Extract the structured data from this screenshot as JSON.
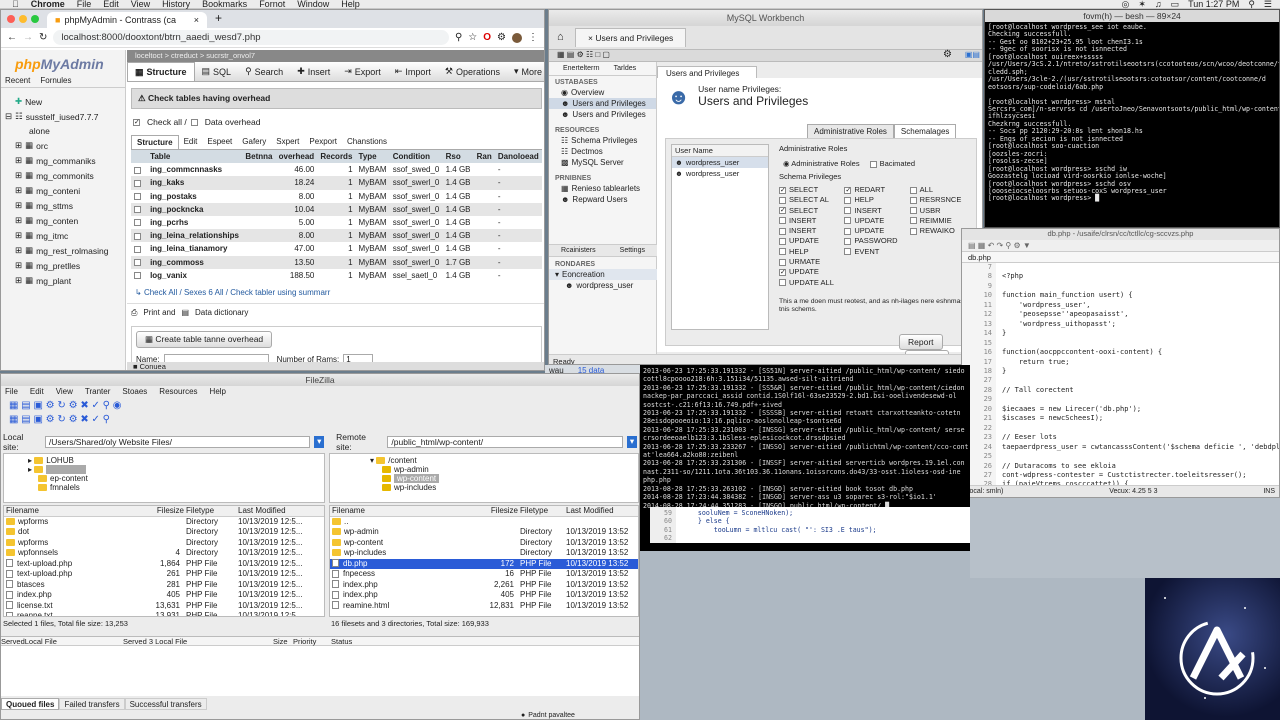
{
  "menubar": {
    "app": "Chrome",
    "items": [
      "File",
      "Edit",
      "View",
      "History",
      "Bookmarks",
      "Fornot",
      "Window",
      "Help"
    ],
    "clock": "Tun 1:27 PM"
  },
  "chrome": {
    "tab_title": "phpMyAdmin - Contrass (ca",
    "url": "localhost:8000/dooxtont/btrn_aaedi_wesd7.php"
  },
  "pma": {
    "logo_a": "php",
    "logo_b": "MyAdmin",
    "recent": "Recent",
    "favorites": "Fornules",
    "tree": [
      "New",
      "susstelf_iused7.7.7",
      "alone",
      "orc",
      "mg_commaniks",
      "mg_commonits",
      "mg_conteni",
      "mg_sttms",
      "mg_conten",
      "mg_itmc",
      "mg_rest_rolmasing",
      "mg_pretlles",
      "mg_plant"
    ],
    "breadcrumb": "loceltoct  >  ctreduct  >  sucrstr_onvol7",
    "tabs": [
      "Structure",
      "SQL",
      "Search",
      "Insert",
      "Export",
      "Import",
      "Operations",
      "More"
    ],
    "notice": "Check tables having overhead",
    "check_all": "Check all /",
    "data_overhead": "Data overhead",
    "subtabs": [
      "Structure",
      "Edit",
      "Espeet",
      "Gafery",
      "Sxpert",
      "Pexport",
      "Chanstions"
    ],
    "columns": [
      "Table",
      "Betnna",
      "overhead",
      "Records",
      "Type",
      "Condition",
      "Rso",
      "Ran",
      "Danoloead"
    ],
    "rows": [
      [
        "ing_commcnnasks",
        "",
        "46.00",
        "1",
        "MyBAM",
        "ssof_swed_0",
        "1.4 GB",
        "",
        "-"
      ],
      [
        "ing_kaks",
        "",
        "18.24",
        "1",
        "MyBAM",
        "ssof_swerl_0",
        "1.4 GB",
        "",
        "-"
      ],
      [
        "ing_postaks",
        "",
        "8.00",
        "1",
        "MyBAM",
        "ssof_swerl_0",
        "1.4 GB",
        "",
        "-"
      ],
      [
        "ing_pockncka",
        "",
        "10.04",
        "1",
        "MyBAM",
        "ssof_swerl_0",
        "1.4 GB",
        "",
        "-"
      ],
      [
        "ing_pcrhs",
        "",
        "5.00",
        "1",
        "MyBAM",
        "ssof_swerl_0",
        "1.4 GB",
        "",
        "-"
      ],
      [
        "ing_leina_relationships",
        "",
        "8.00",
        "1",
        "MyBAM",
        "ssof_swerl_0",
        "1.4 GB",
        "",
        "-"
      ],
      [
        "ing_leina_tianamory",
        "",
        "47.00",
        "1",
        "MyBAM",
        "ssof_swerl_0",
        "1.4 GB",
        "",
        "-"
      ],
      [
        "ing_commoss",
        "",
        "13.50",
        "1",
        "MyBAM",
        "ssof_swerl_0",
        "1.7 GB",
        "",
        "-"
      ],
      [
        "log_vanix",
        "",
        "188.50",
        "1",
        "MyBAM",
        "ssel_saetl_0",
        "1.4 GB",
        "",
        "-"
      ]
    ],
    "footer_check": "Check All / Sexes 6 All / Check tabler using summarr",
    "print": "Print and",
    "data_dict": "Data dictionary",
    "create_btn": "Create table tanne overhead",
    "name_label": "Name:",
    "cols_label": "Number of Rams:",
    "cols_value": "1",
    "console": "Conuea"
  },
  "wb": {
    "title": "MySQL Workbench",
    "tab": "Users and Privileges",
    "side_tabs": [
      "Enertelterrn",
      "Tarldes"
    ],
    "main_tab": "Users and Privileges",
    "groups": [
      {
        "hdr": "USTABASES",
        "items": [
          "Overview",
          "Users and Privileges",
          "Users and Privileges"
        ]
      },
      {
        "hdr": "RESOURCES",
        "items": [
          "Schema Privileges",
          "Dectmos",
          "MySQL Server"
        ]
      },
      {
        "hdr": "PRNIBNES",
        "items": [
          "Renieso tablearlets",
          "Repward Users"
        ]
      }
    ],
    "side_bottom": [
      "Rcainisters",
      "Settings"
    ],
    "rondares": "RONDARES",
    "econ": "Eoncreation",
    "econ_user": "wordpress_user",
    "header_sub": "User name Privileges:",
    "header_title": "Users and Privileges",
    "right_tabs": [
      "Administrative Roles",
      "Schemalages"
    ],
    "user_list_hdr": "User Name",
    "users": [
      "wordpress_user",
      "wordpress_user"
    ],
    "admin_roles": "Administrative Roles",
    "radio_a": "Administrative Roles",
    "radio_b": "Bacimated",
    "schema_priv": "Schema Privileges",
    "priv_col1": [
      [
        "SELECT",
        true
      ],
      [
        "SELECT AL",
        false
      ],
      [
        "SELECT",
        true
      ],
      [
        "INSERT",
        false
      ],
      [
        "INSERT",
        false
      ],
      [
        "UPDATE",
        false
      ],
      [
        "HELP",
        false
      ],
      [
        "URMATE",
        false
      ],
      [
        "UPDATE",
        true
      ],
      [
        "UPDATE ALL",
        false
      ]
    ],
    "priv_col2": [
      [
        "REDART",
        true
      ],
      [
        "HELP",
        false
      ],
      [
        "INSERT",
        false
      ],
      [
        "UPDATE",
        false
      ],
      [
        "UPDATE",
        false
      ],
      [
        "PASSWORD",
        false
      ],
      [
        "EVENT",
        false
      ]
    ],
    "priv_col3": [
      [
        "ALL",
        false
      ],
      [
        "RESRSNCE",
        false
      ],
      [
        "USBR",
        false
      ],
      [
        "REIMMIE",
        false
      ],
      [
        "REWAIKO",
        false
      ]
    ],
    "note": "This a me doen must reotest, and as nh-ilages nere eshnmasing tnis schems.",
    "report": "Report",
    "cancel": "Cancel",
    "status": "Ready"
  },
  "term1": {
    "title": "fovm(h) — besh — 89×24",
    "lines": [
      "[root@localhost wordpress_see iot eaube.",
      "Checking successfull.",
      "-- Gest oo 8102+23+25.95 loot chenI3.1s",
      "-- 9gec of soorisx is not isnnected",
      "[root@localhost ouireex+sssss",
      "/usr/Users/3cS.2.1/ntreto/sstrotilseootsrs(ccotooteos/scn/wcoo/deotconne/t",
      "cledd.sph;",
      "/usr/Users/3cle-2./(usr/sstrotilseootsrs:cotootsor/content/cootconne/d",
      "eotsosrs/sup-codeloid/6ab.php",
      "",
      "[root@localhost wordpress> mstal",
      "Sercsrs_com]/n-servrss cd /usertoJneo/Senavontsoots/public_html/wp-content",
      "ifhlzsycsesi",
      "Chezkrng successfull.",
      "-- Socs pp 2120:29-20:8s lent shon18.hs",
      "-- Engs of secion is not isnnected",
      "[root@localhost soo-cuaction",
      "[oozsles-zocri:",
      "[rosolss-zecse]",
      "[root@localhost wordpress> sschd iw",
      "Goozastelg locioad vird-oosrkio ionlse-woche]",
      "[root@localhost wordpress> sschd osv",
      "[oooseiocseloosrbs setuos-coxS wordpress_user",
      "[root@localhost wordpress> "
    ]
  },
  "editor": {
    "path": "db.php - /usaife/clrsn/cc/tctllc/cg-sccvzs.php",
    "tab": "db.php",
    "gutter": [
      "7",
      "8",
      "9",
      "10",
      "11",
      "12",
      "13",
      "14",
      "15",
      "16",
      "17",
      "18",
      "27",
      "28",
      "29",
      "20",
      "21",
      "22",
      "23",
      "24",
      "25",
      "26",
      "27",
      "28",
      "29",
      "30"
    ],
    "lines": [
      "",
      "<?php",
      "",
      "function main_function usert) {",
      "    'wordpress_user',",
      "    'peosepsse''apeopasaisst',",
      "    'wordpress_uithopasst';",
      "}",
      "",
      "function(aocppccontent-ooxi-content) {",
      "    return true;",
      "}",
      "",
      "// Tall corectent",
      "",
      "$iecaaes = new Lirecer('db.php');",
      "$iscases = newcScheesI);",
      "",
      "// Eeser lots",
      "taepaerdpress_user = cwtancasssContent('$schema deficie ', 'debdpl');",
      "",
      "// Dutaracoms to see ekloia",
      "cont-wdpress-contester = Custctistrecter.toeleitsresser();",
      "if (paieVtrems.coscccattet)) {",
      "   (wiesttresse-ocsteitr = coucntel(npptcclalite.collig).size(ihe",
      "   if (pstttresse-ccosstzr.courstst)) {"
    ],
    "status_left": "Tocal: smln)",
    "status_mid": "Vecux: 4.25 5 3",
    "status_right": "INS"
  },
  "term2": {
    "lines": [
      "2013-06-23 17:25:33.191332 - [SS51N] server-aitied /public_html/wp-content/ siedo",
      "cottl8cpoooo218:6h:3.151i34/51135.awsed-silt-aitriend",
      "2013-06-23 17:25:33.191332 - [SS5&R] server-eitied /public_html/wp-content/ciedon",
      "nackep-par_parccaci_assid contid.1S0lf16l-63se23529-2.bd1.bsi-ooelivendesewd-ol",
      "sostcst-.c21:6f13:16.749.pdf+-sived",
      "2013-06-23 17:25:33.191332 - [SSSSB] server-eitied retoatt ctarxotteankto-cotetn",
      "28eisdopooeoio:13:16.pqlico-aoslonolleap-tsontse6d",
      "2013-06-28 17:25:33.231003 - [INSSG] server-eitied /public_html/wp-content/ serse",
      "crsordeeoaelb123:3.1bSless-eplesicockcot.drssdpsied",
      "2013-06-28 17:25:33.233267 - [INSSO] server-eitied /publichtml/wp-content/cco-cont",
      "at'lea664.a2ko80:zeibenl",
      "2013-06-28 17:25:33.231306 - [INSSF] server-aitied serverticb wordpres.19.1el.con",
      "nast.2311-so/1211.1ota.36t103.36.11onans.1oissrcons.do43/33-osst.1ioless-osd-ine",
      "php.php",
      "2013-08-28 17:25:33.263102 - [INSGD] server-eitied book tosot db.php",
      "2014-08-28 17:23:44.384382 - [INSGD] server-ass u3 soparec s3-rol:\"$io1.1'",
      "2014-08-28 17:24:44.351283 - [INSGO] public_html/wp-content/ "
    ],
    "code_gutter": [
      "59",
      "60",
      "61",
      "62"
    ],
    "code_lines": [
      "    sooluNem = SconeHNoken);",
      "    } else {",
      "        tooLumn = mltlcu cast( \"': SI3 .E taus\");",
      ""
    ]
  },
  "fz": {
    "title": "FileZilla",
    "menu": [
      "File",
      "Edit",
      "View",
      "Tranter",
      "Stoaes",
      "Resources",
      "Help"
    ],
    "local_label": "Local site:",
    "local_path": "/Users/Shared/oly Website Files/",
    "remote_label": "Remote site:",
    "remote_path": "/public_html/wp-content/",
    "local_tree": [
      "LOHUB",
      "",
      "ep-content",
      "fmnalels"
    ],
    "remote_tree": [
      "/content",
      "wp-admin",
      "wp-content",
      "wp-includes"
    ],
    "cols_local": [
      "Filename",
      "Filesize",
      "Filetype",
      "Last Modified"
    ],
    "local_files": [
      [
        "wpforms",
        "",
        "Directory",
        "10/13/2019 12:5..."
      ],
      [
        "dot",
        "",
        "Directory",
        "10/13/2019 12:5..."
      ],
      [
        "wpforms",
        "",
        "Directory",
        "10/13/2019 12:5..."
      ],
      [
        "wpfonnsels",
        "4",
        "Directory",
        "10/13/2019 12:5..."
      ],
      [
        "text-upload.php",
        "1,864",
        "PHP File",
        "10/13/2019 12:5..."
      ],
      [
        "text-upload.php",
        "261",
        "PHP File",
        "10/13/2019 12:5..."
      ],
      [
        "btasces",
        "281",
        "PHP File",
        "10/13/2019 12:5..."
      ],
      [
        "index.php",
        "405",
        "PHP File",
        "10/13/2019 12:5..."
      ],
      [
        "license.txt",
        "13,631",
        "PHP File",
        "10/13/2019 12:5..."
      ],
      [
        "reanne.txt",
        "13,931",
        "PHP File",
        "10/13/2019 12:5..."
      ]
    ],
    "remote_files": [
      [
        "..",
        "",
        "",
        ""
      ],
      [
        "wp-admin",
        "",
        "Directory",
        "10/13/2019 13:52"
      ],
      [
        "wp-content",
        "",
        "Directory",
        "10/13/2019 13:52"
      ],
      [
        "wp-includes",
        "",
        "Directory",
        "10/13/2019 13:52"
      ],
      [
        "db.php",
        "172",
        "PHP File",
        "10/13/2019 13:52"
      ],
      [
        "fnpecess",
        "16",
        "PHP File",
        "10/13/2019 13:52"
      ],
      [
        "index.php",
        "2,261",
        "PHP File",
        "10/13/2019 13:52"
      ],
      [
        "index.php",
        "405",
        "PHP File",
        "10/13/2019 13:52"
      ],
      [
        "reamine.html",
        "12,831",
        "PHP File",
        "10/13/2019 13:52"
      ]
    ],
    "local_status": "Selected 1 files, Total file size: 13,253",
    "remote_status": "16 filesets and 3 directories, Total size: 169,933",
    "queue_cols": [
      "ServedLocal File",
      "Served 3 Local File",
      "Size",
      "Priority",
      "Status"
    ],
    "queue_tabs": [
      "Quoued files",
      "Failed transfers",
      "Successful transfers"
    ],
    "bottom_status": "Padnt pavaltee"
  },
  "misc": {
    "wau": "wau",
    "data15": "15 data"
  }
}
